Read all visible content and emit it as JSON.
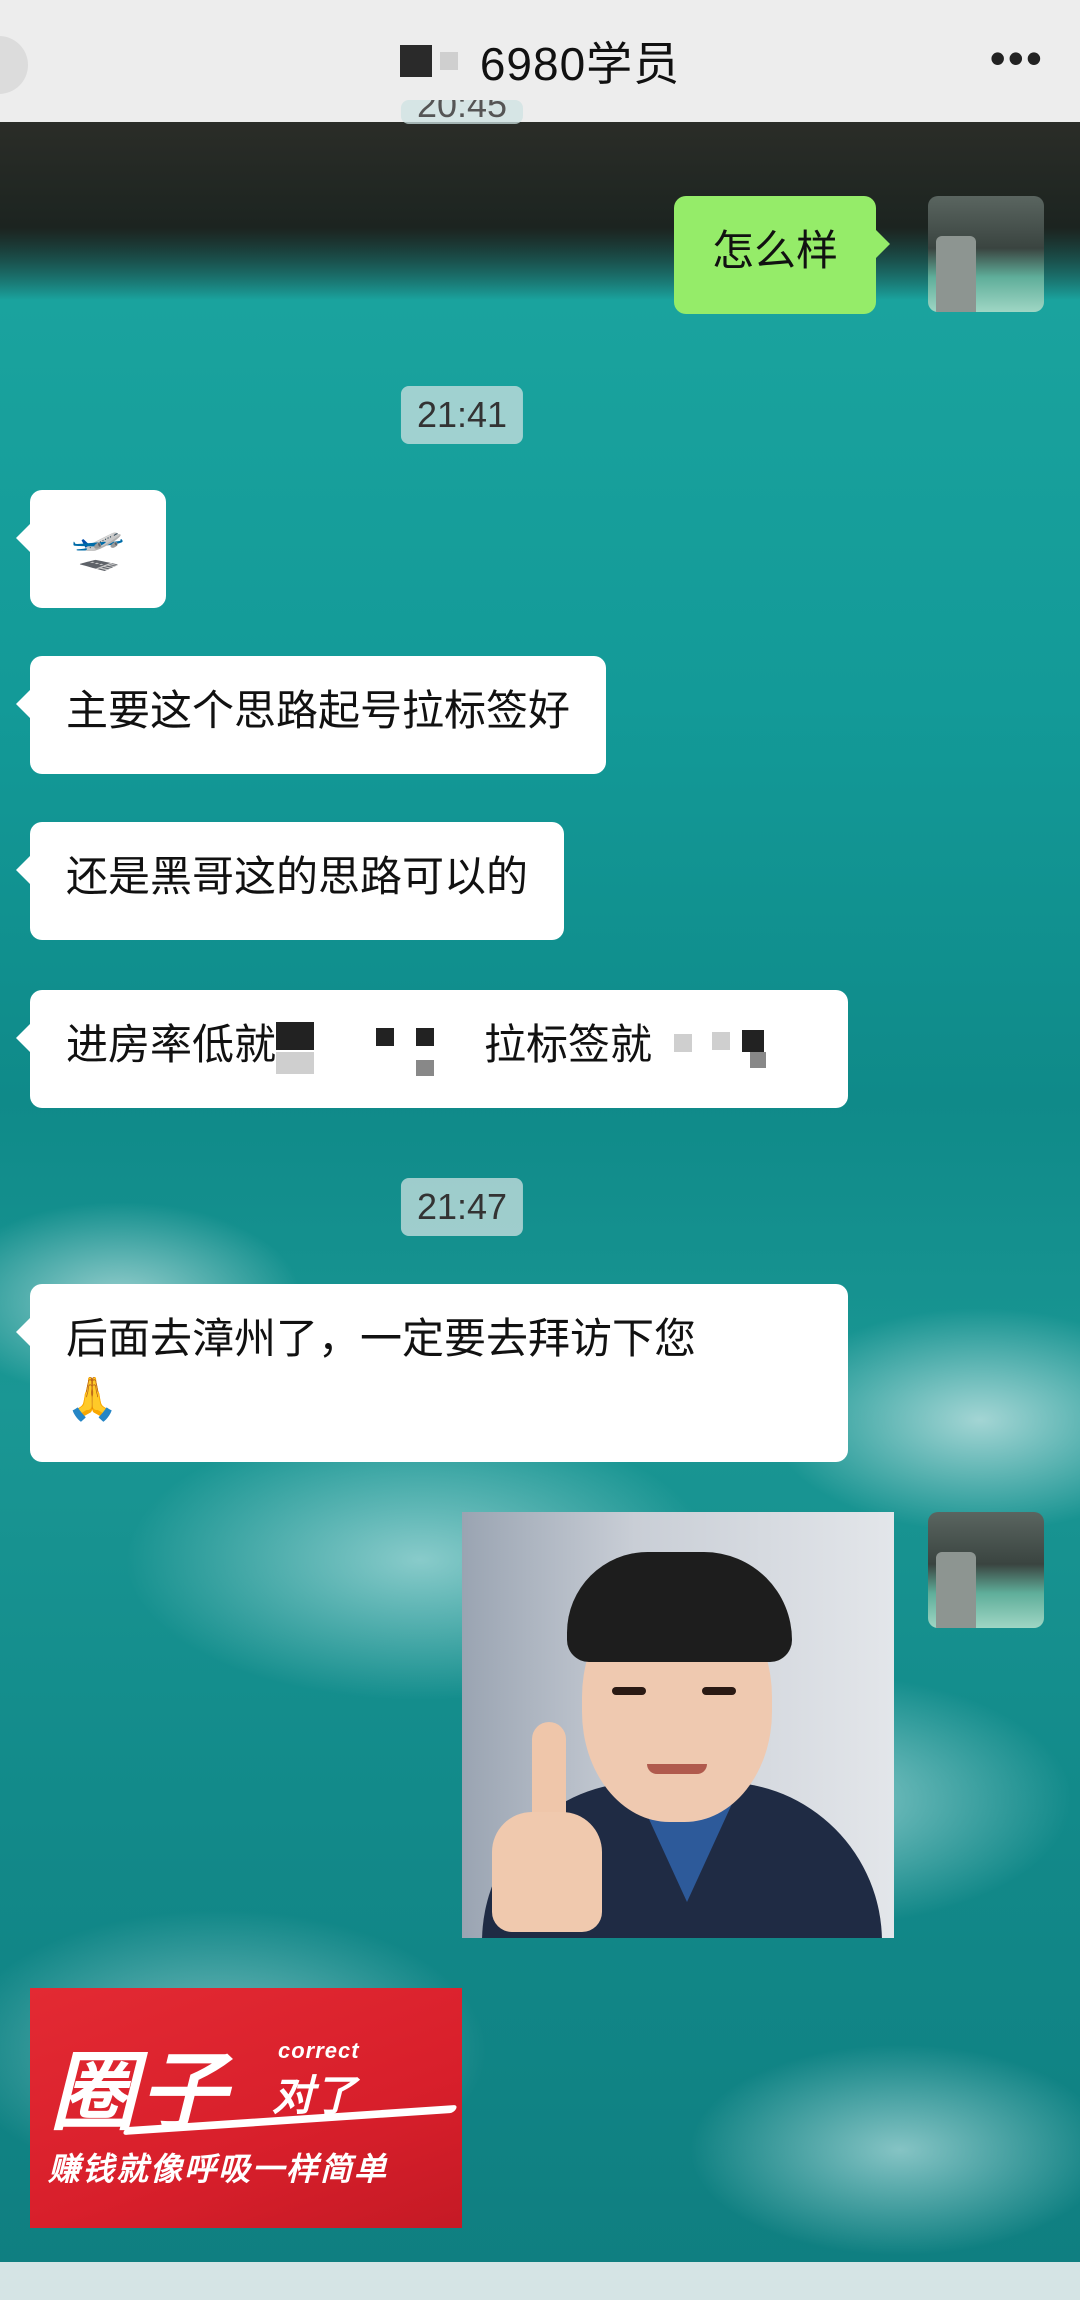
{
  "header": {
    "title": "6980学员",
    "more_icon": "more-dots-icon",
    "more_label": "•••"
  },
  "messages": {
    "time_top": "20:45",
    "m1": "怎么样",
    "time1": "21:41",
    "m2_icon": "airplane-emoji",
    "m2_glyph": "🛫",
    "m3": "主要这个思路起号拉标签好",
    "m4": "还是黑哥这的思路可以的",
    "m5_a": "进房率低就",
    "m5_b": "拉标签就",
    "time2": "21:47",
    "m6_line1": "后面去漳州了，一定要去拜访下您",
    "m6_emoji": "🙏"
  },
  "banner": {
    "big_text": "圈子",
    "english": "correct",
    "mid_text": "对了",
    "slogan": "赚钱就像呼吸一样简单"
  },
  "colors": {
    "header_bg": "#ededed",
    "green_bubble": "#95ec69",
    "banner_red": "#e32a33"
  }
}
